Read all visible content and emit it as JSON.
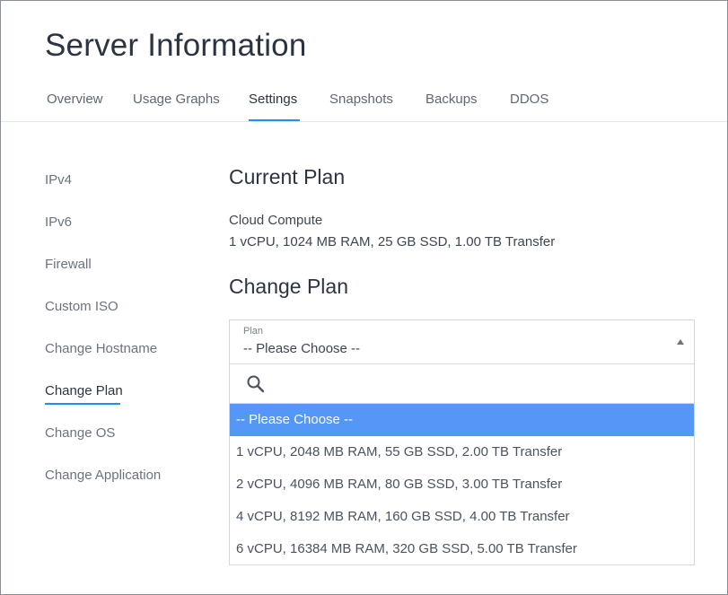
{
  "page_title": "Server Information",
  "tabs": [
    {
      "label": "Overview"
    },
    {
      "label": "Usage Graphs"
    },
    {
      "label": "Settings",
      "active": true
    },
    {
      "label": "Snapshots"
    },
    {
      "label": "Backups"
    },
    {
      "label": "DDOS"
    }
  ],
  "sidebar": {
    "items": [
      {
        "label": "IPv4"
      },
      {
        "label": "IPv6"
      },
      {
        "label": "Firewall"
      },
      {
        "label": "Custom ISO"
      },
      {
        "label": "Change Hostname"
      },
      {
        "label": "Change Plan",
        "active": true
      },
      {
        "label": "Change OS"
      },
      {
        "label": "Change Application"
      }
    ]
  },
  "current_plan": {
    "heading": "Current Plan",
    "name": "Cloud Compute",
    "details": "1 vCPU, 1024 MB RAM, 25 GB SSD, 1.00 TB Transfer"
  },
  "change_plan": {
    "heading": "Change Plan",
    "select": {
      "label": "Plan",
      "value": "-- Please Choose --",
      "search_placeholder": "",
      "options": [
        {
          "label": "-- Please Choose --",
          "selected": true
        },
        {
          "label": "1 vCPU, 2048 MB RAM, 55 GB SSD, 2.00 TB Transfer"
        },
        {
          "label": "2 vCPU, 4096 MB RAM, 80 GB SSD, 3.00 TB Transfer"
        },
        {
          "label": "4 vCPU, 8192 MB RAM, 160 GB SSD, 4.00 TB Transfer"
        },
        {
          "label": "6 vCPU, 16384 MB RAM, 320 GB SSD, 5.00 TB Transfer"
        }
      ]
    }
  },
  "colors": {
    "accent": "#1f8ff5",
    "selected_option_bg": "#5597f7",
    "title_text": "#2b3440",
    "muted_text": "#6a737e"
  },
  "icons": {
    "search": "search-icon",
    "dropdown_caret": "caret-up-icon"
  }
}
